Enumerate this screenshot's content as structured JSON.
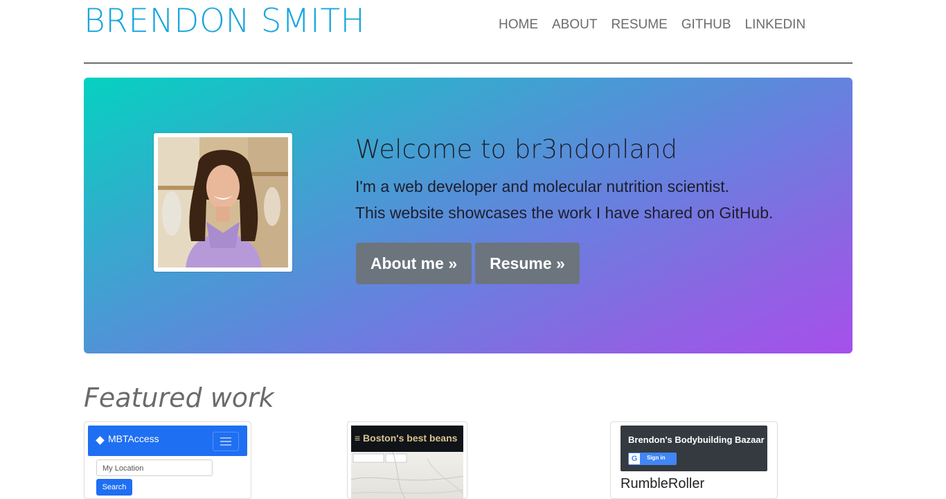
{
  "header": {
    "site_title": "BRENDON SMITH",
    "nav": [
      "HOME",
      "ABOUT",
      "RESUME",
      "GITHUB",
      "LINKEDIN"
    ]
  },
  "hero": {
    "title": "Welcome to br3ndonland",
    "line1": "I'm a web developer and molecular nutrition scientist.",
    "line2": "This website showcases the work I have shared on GitHub.",
    "about_button": "About me »",
    "resume_button": "Resume »",
    "gradient_colors": [
      "#05d1c0",
      "#a64feb"
    ]
  },
  "featured": {
    "heading": "Featured work",
    "cards": [
      {
        "app_title": "MBTAccess",
        "input_placeholder": "My Location",
        "button": "Search"
      },
      {
        "app_title": "≡ Boston's best beans"
      },
      {
        "app_title": "Brendon's Bodybuilding Bazaar",
        "signin_label": "Sign in",
        "name": "RumbleRoller"
      }
    ]
  },
  "colors": {
    "brand": "#1aa6dd",
    "nav_text": "#6b6b6b",
    "button_gray": "#6c757d",
    "primary_blue": "#1f6ff2"
  }
}
